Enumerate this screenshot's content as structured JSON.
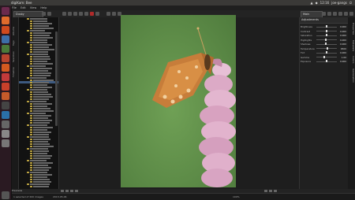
{
  "app": {
    "title": "digiKam"
  },
  "top_panel": {
    "app_name": "digiKam: Bee",
    "clock": "12:16",
    "user": "joe-gangs"
  },
  "menubar": [
    "File",
    "Edit",
    "View",
    "Help"
  ],
  "toolbar": {
    "album_combo": "Dusky",
    "tool_combo": "Main Sharpen"
  },
  "left_tabs": [
    "Albums",
    "Tags",
    "Searches",
    "Timeline"
  ],
  "tree": {
    "items_count_label": ""
  },
  "right_panel": {
    "header": "Adjustments",
    "sliders": [
      {
        "label": "Brightness",
        "value": "0.000",
        "pos": 0.5
      },
      {
        "label": "Contrast",
        "value": "0.000",
        "pos": 0.5
      },
      {
        "label": "Saturation",
        "value": "0.000",
        "pos": 0.5
      },
      {
        "label": "Highlights",
        "value": "0.000",
        "pos": 0.45
      },
      {
        "label": "Shadows",
        "value": "0.000",
        "pos": 0.45
      },
      {
        "label": "Temperature",
        "value": "6500",
        "pos": 0.55
      },
      {
        "label": "Tint",
        "value": "0.000",
        "pos": 0.5
      },
      {
        "label": "Gamma",
        "value": "1.00",
        "pos": 0.4
      },
      {
        "label": "Exposure",
        "value": "0.000",
        "pos": 0.5
      }
    ],
    "right_tabs": [
      "Properties",
      "Metadata",
      "Colors",
      "Geolocation"
    ]
  },
  "bottom_left": {
    "label": "Previews"
  },
  "statusbar": {
    "left": "1 selected of 200 images",
    "middle": "2013-05-06",
    "right": "100%"
  },
  "colors": {
    "photo_background_green": "#5f8e49",
    "butterfly_orange": "#c77d3a",
    "flower_pink": "#d9a2c2"
  }
}
